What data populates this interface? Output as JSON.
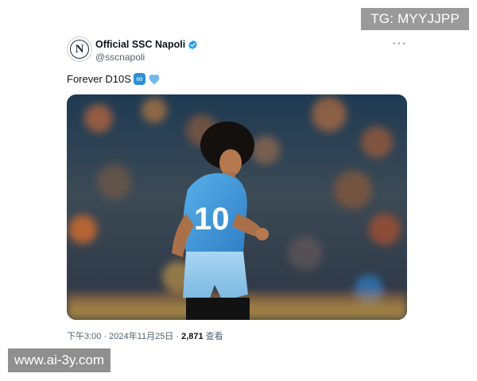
{
  "watermarks": {
    "top": "TG: MYYJJPP",
    "bottom": "www.ai-3y.com"
  },
  "tweet": {
    "author_name": "Official SSC Napoli",
    "handle": "@sscnapoli",
    "avatar_letter": "N",
    "more_label": "···",
    "text": "Forever D10S",
    "emojis": [
      "infinity-icon",
      "blue-heart-icon"
    ],
    "shirt_number": "10",
    "time": "下午3:00 · 2024年11月25日 · ",
    "views_count": "2,871",
    "views_label": " 查看"
  },
  "colors": {
    "verified_badge": "#1d9bf0",
    "napoli_blue": "#3f9ad8",
    "heart_blue": "#74b9ea"
  }
}
